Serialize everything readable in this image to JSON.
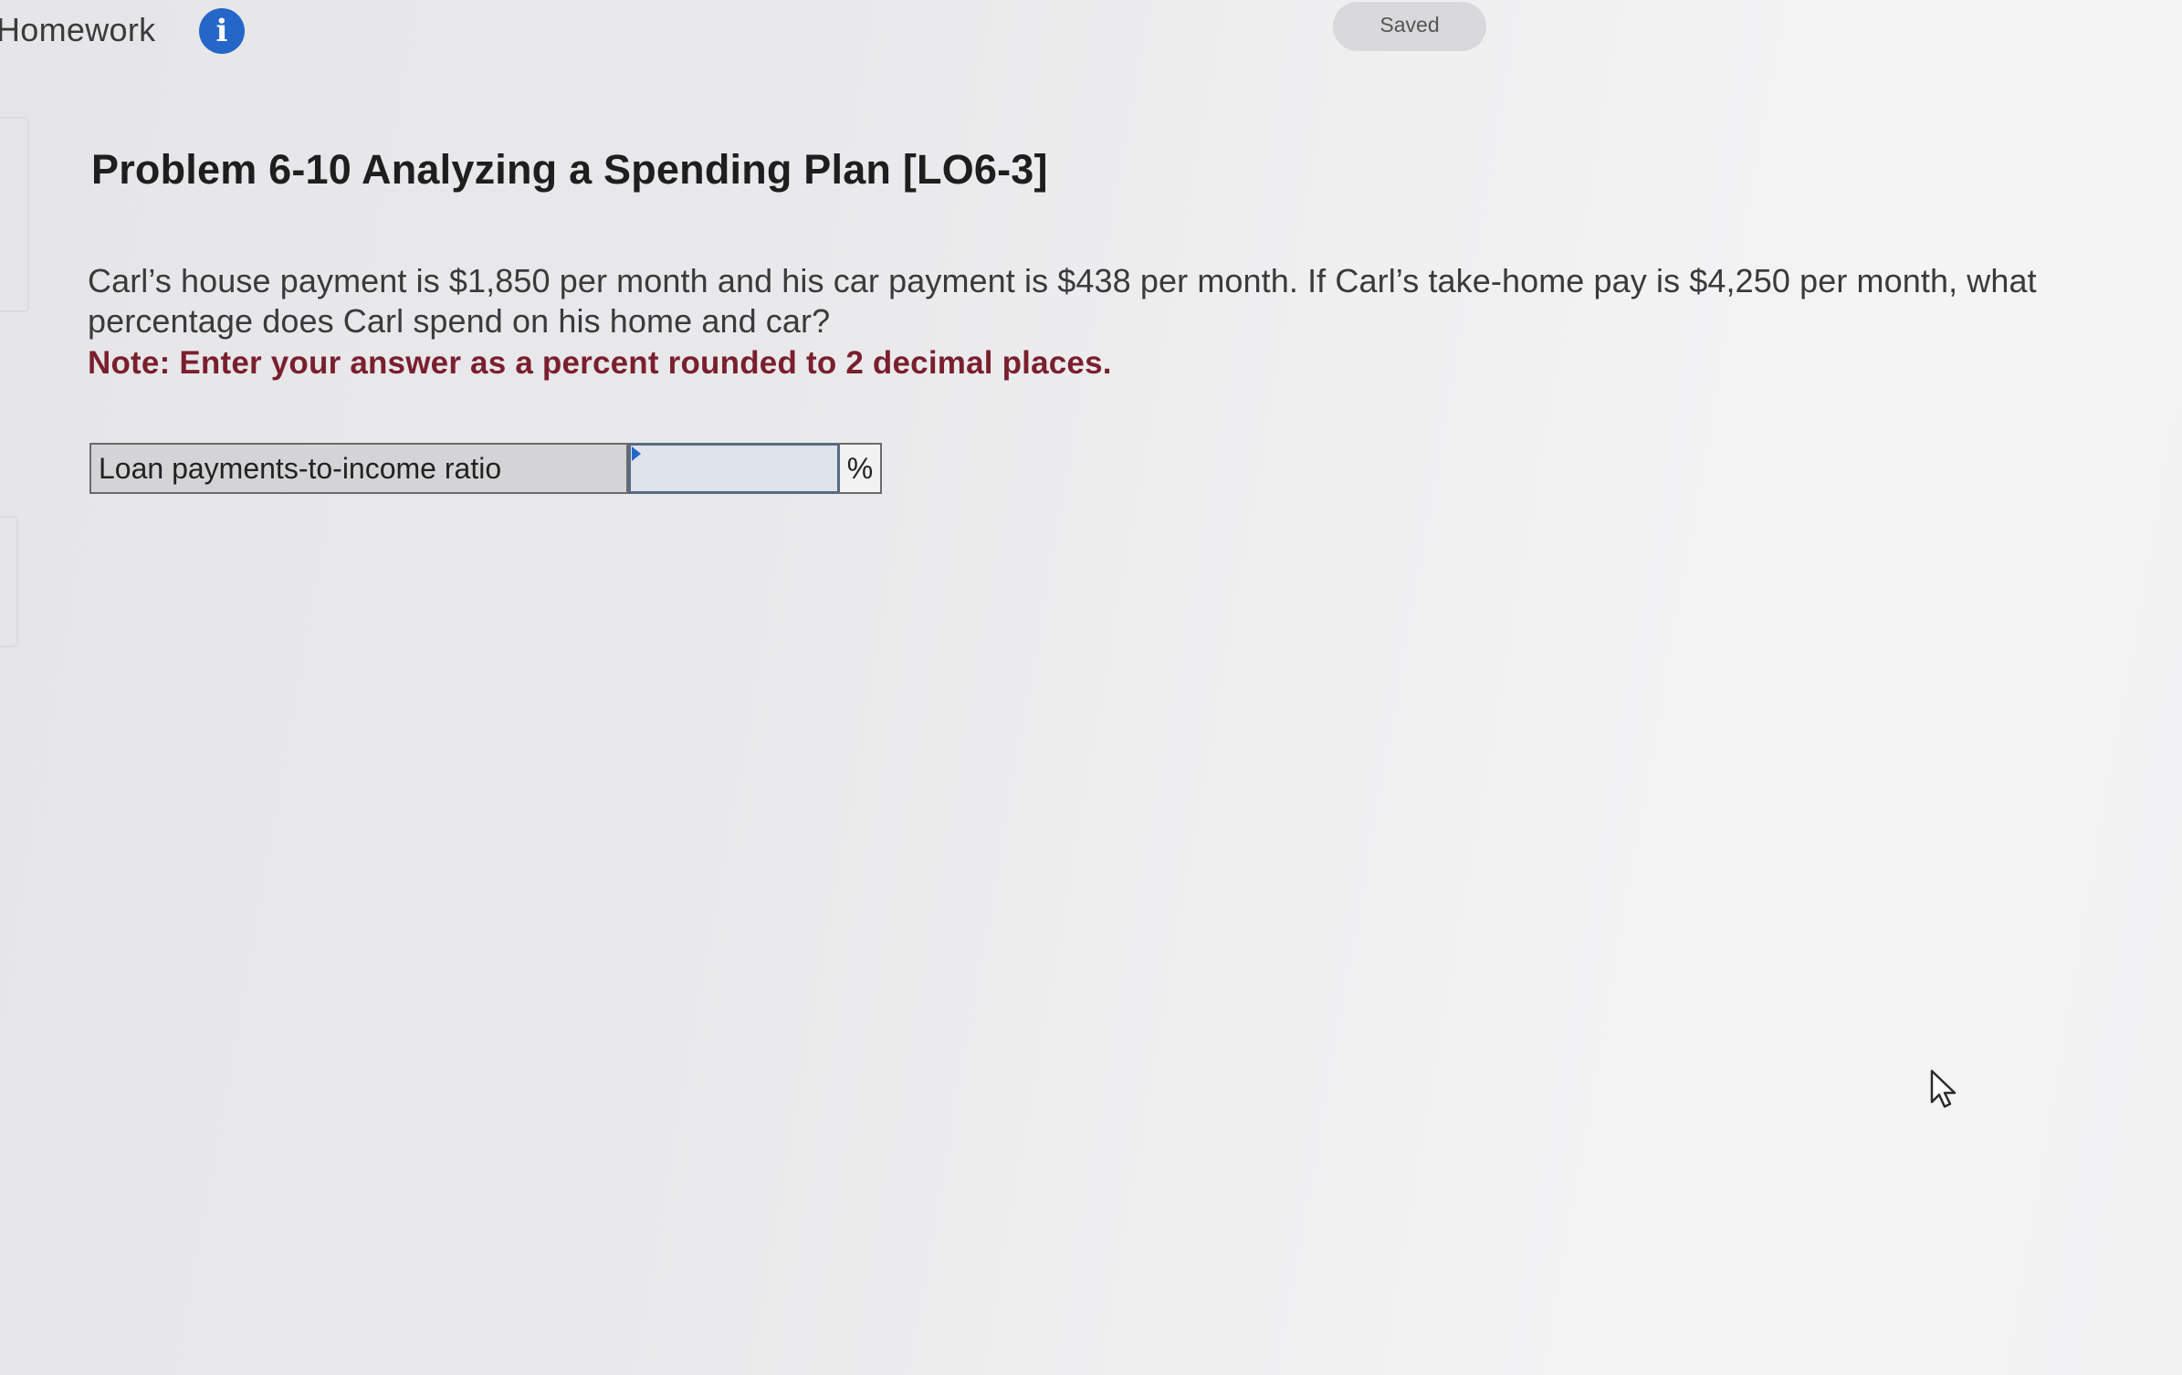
{
  "header": {
    "title": "Homework",
    "info_glyph": "i",
    "saved_label": "Saved"
  },
  "problem": {
    "title": "Problem 6-10 Analyzing a Spending Plan [LO6-3]",
    "question": "Carl’s house payment is $1,850 per month and his car payment is $438 per month. If Carl’s take-home pay is $4,250 per month, what percentage does Carl spend on his home and car?",
    "note": "Note: Enter your answer as a percent rounded to 2 decimal places."
  },
  "answer": {
    "label": "Loan payments-to-income ratio",
    "value": "",
    "unit": "%"
  },
  "icons": {
    "info": "info-icon",
    "pointer": "mouse-pointer-icon"
  },
  "colors": {
    "info_blue": "#2467c8",
    "note_red": "#7a1f2e"
  }
}
